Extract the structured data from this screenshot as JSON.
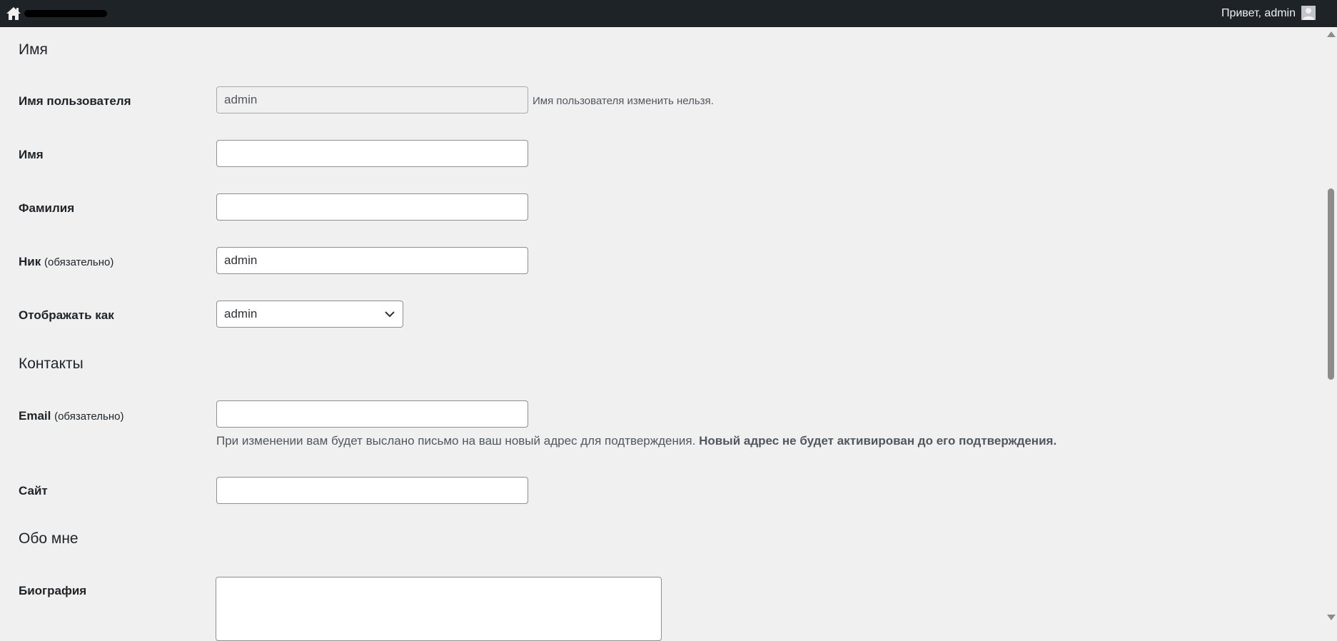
{
  "adminbar": {
    "greeting": "Привет, admin",
    "home_icon": "home-icon",
    "avatar_icon": "avatar-icon"
  },
  "sections": {
    "name": "Имя",
    "contacts": "Контакты",
    "about": "Обо мне"
  },
  "fields": {
    "username": {
      "label": "Имя пользователя",
      "value": "admin",
      "description": "Имя пользователя изменить нельзя."
    },
    "first_name": {
      "label": "Имя",
      "value": ""
    },
    "last_name": {
      "label": "Фамилия",
      "value": ""
    },
    "nickname": {
      "label": "Ник",
      "required": "(обязательно)",
      "value": "admin"
    },
    "display_name": {
      "label": "Отображать как",
      "selected": "admin"
    },
    "email": {
      "label": "Email",
      "required": "(обязательно)",
      "value": "",
      "description": "При изменении вам будет выслано письмо на ваш новый адрес для подтверждения.",
      "description_strong": "Новый адрес не будет активирован до его подтверждения."
    },
    "website": {
      "label": "Сайт",
      "value": ""
    },
    "bio": {
      "label": "Биография",
      "value": ""
    }
  }
}
